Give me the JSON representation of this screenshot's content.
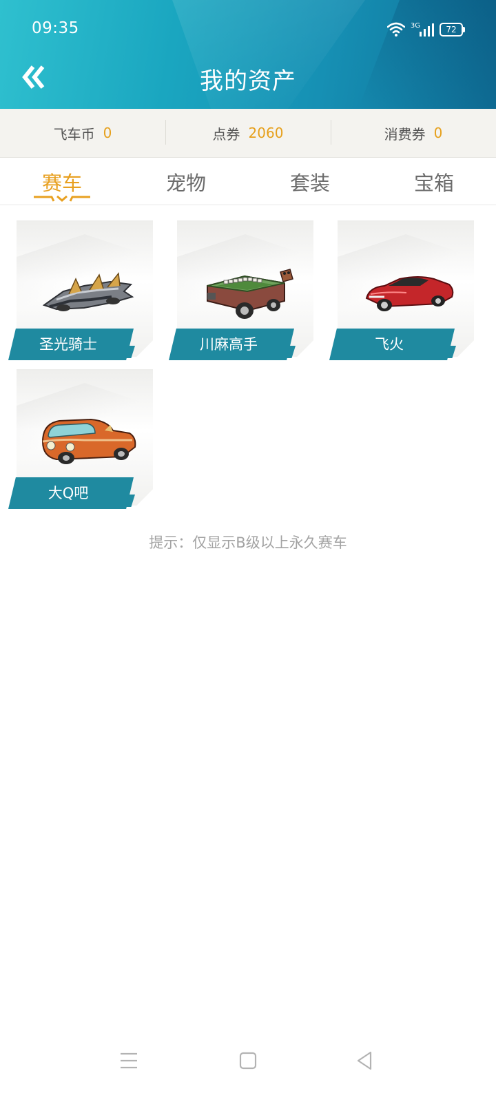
{
  "status_bar": {
    "time": "09:35",
    "network": "3G",
    "battery": "72",
    "icons": [
      "wifi-icon",
      "cellular-signal-icon",
      "battery-icon"
    ]
  },
  "header": {
    "title": "我的资产",
    "back_icon": "double-chevron-left-icon"
  },
  "currencies": [
    {
      "label": "飞车币",
      "value": "0"
    },
    {
      "label": "点券",
      "value": "2060"
    },
    {
      "label": "消费券",
      "value": "0"
    }
  ],
  "tabs": [
    {
      "label": "赛车",
      "active": true
    },
    {
      "label": "宠物",
      "active": false
    },
    {
      "label": "套装",
      "active": false
    },
    {
      "label": "宝箱",
      "active": false
    }
  ],
  "cars": [
    {
      "name": "圣光骑士",
      "image": "silver-armored-kart-image"
    },
    {
      "name": "川麻高手",
      "image": "mahjong-table-kart-image"
    },
    {
      "name": "飞火",
      "image": "red-sports-car-image"
    },
    {
      "name": "大Q吧",
      "image": "orange-van-kart-image"
    }
  ],
  "hint": "提示：仅显示B级以上永久赛车",
  "nav_bar": {
    "buttons": [
      "menu-icon",
      "home-icon",
      "back-triangle-icon"
    ]
  },
  "colors": {
    "header_start": "#2fc0cf",
    "header_end": "#0f6f97",
    "accent": "#e8a020",
    "banner": "#1f8aa0",
    "currency_value": "#e6a01c"
  }
}
